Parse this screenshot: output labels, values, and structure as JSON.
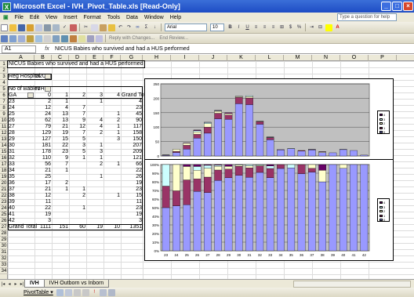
{
  "window": {
    "title": "Microsoft Excel - IVH_Pivot_Table.xls  [Read-Only]",
    "app_icon": "excel-icon"
  },
  "menu": {
    "items": [
      "File",
      "Edit",
      "View",
      "Insert",
      "Format",
      "Tools",
      "Data",
      "Window",
      "Help"
    ],
    "help_placeholder": "Type a question for help"
  },
  "toolbar": {
    "font_name": "Arial",
    "font_size": "10",
    "reply_label": "Reply with Changes...",
    "end_review_label": "End Review..."
  },
  "formula": {
    "cell_ref": "A1",
    "fx": "fx",
    "content": "NICUS Babies who survived and had a HUS performed"
  },
  "columns": [
    "A",
    "B",
    "C",
    "D",
    "E",
    "F",
    "G",
    "H",
    "I",
    "J",
    "K",
    "L",
    "M",
    "N",
    "O",
    "P"
  ],
  "rows": [
    "1",
    "2",
    "3",
    "4",
    "5",
    "6",
    "7",
    "8",
    "9",
    "10",
    "11",
    "12",
    "13",
    "14",
    "15",
    "16",
    "17",
    "18",
    "19",
    "20",
    "21",
    "22",
    "23",
    "24",
    "25",
    "26",
    "27",
    "28",
    "29",
    "30",
    "31",
    "32",
    "33",
    "34"
  ],
  "sheet": {
    "a1": "NICUS Babies who survived and had a HUS performed",
    "filter_label": "Reg Hospital",
    "filter_value": "D209",
    "data_label": "No of Babies",
    "col_field": "IVH",
    "row_field": "GA",
    "col_headers": [
      "0",
      "1",
      "2",
      "3",
      "4",
      "Grand Total"
    ],
    "table": [
      [
        "23",
        "2",
        "1",
        "",
        "1",
        "",
        "4"
      ],
      [
        "24",
        "12",
        "4",
        "7",
        "",
        "",
        "23"
      ],
      [
        "25",
        "24",
        "13",
        "7",
        "",
        "1",
        "45"
      ],
      [
        "26",
        "62",
        "13",
        "9",
        "4",
        "2",
        "90"
      ],
      [
        "27",
        "79",
        "21",
        "12",
        "4",
        "1",
        "117"
      ],
      [
        "28",
        "129",
        "19",
        "7",
        "2",
        "1",
        "158"
      ],
      [
        "29",
        "127",
        "15",
        "5",
        "",
        "3",
        "150"
      ],
      [
        "30",
        "181",
        "22",
        "3",
        "1",
        "",
        "207"
      ],
      [
        "31",
        "178",
        "23",
        "5",
        "3",
        "",
        "209"
      ],
      [
        "32",
        "110",
        "9",
        "1",
        "1",
        "",
        "121"
      ],
      [
        "33",
        "56",
        "7",
        "",
        "2",
        "1",
        "66"
      ],
      [
        "34",
        "21",
        "1",
        "",
        "",
        "",
        "22"
      ],
      [
        "35",
        "25",
        "",
        "",
        "1",
        "",
        "26"
      ],
      [
        "36",
        "17",
        "2",
        "",
        "",
        "",
        "19"
      ],
      [
        "37",
        "21",
        "1",
        "1",
        "",
        "",
        "23"
      ],
      [
        "38",
        "12",
        "",
        "2",
        "",
        "1",
        "15"
      ],
      [
        "39",
        "11",
        "",
        "",
        "",
        "",
        "11"
      ],
      [
        "40",
        "22",
        "",
        "1",
        "",
        "",
        "23"
      ],
      [
        "41",
        "19",
        "",
        "",
        "",
        "",
        "19"
      ],
      [
        "42",
        "3",
        "",
        "",
        "",
        "",
        "3"
      ]
    ],
    "grand_total": [
      "Grand Total",
      "1111",
      "151",
      "60",
      "19",
      "10",
      "1351"
    ]
  },
  "tabs": {
    "active": "IVH",
    "items": [
      "IVH",
      "IVH Outborn vs Inborn"
    ]
  },
  "pivot_toolbar": {
    "label": "PivotTable ▾"
  },
  "colors": {
    "s0": "#9999ff",
    "s1": "#993366",
    "s2": "#ffffcc",
    "s3": "#ccffff",
    "s4": "#660066",
    "plot_bg": "#c0c0c0"
  },
  "chart_data": [
    {
      "type": "bar",
      "stacked": true,
      "categories": [
        "23",
        "24",
        "25",
        "26",
        "27",
        "28",
        "29",
        "30",
        "31",
        "32",
        "33",
        "34",
        "35",
        "36",
        "37",
        "38",
        "39",
        "40",
        "41",
        "42"
      ],
      "series": [
        {
          "name": "0",
          "values": [
            2,
            12,
            24,
            62,
            79,
            129,
            127,
            181,
            178,
            110,
            56,
            21,
            25,
            17,
            21,
            12,
            11,
            22,
            19,
            3
          ]
        },
        {
          "name": "1",
          "values": [
            1,
            4,
            13,
            13,
            21,
            19,
            15,
            22,
            23,
            9,
            7,
            1,
            0,
            2,
            1,
            0,
            0,
            0,
            0,
            0
          ]
        },
        {
          "name": "2",
          "values": [
            0,
            7,
            7,
            9,
            12,
            7,
            5,
            3,
            5,
            1,
            0,
            0,
            0,
            0,
            1,
            2,
            0,
            1,
            0,
            0
          ]
        },
        {
          "name": "3",
          "values": [
            1,
            0,
            0,
            4,
            4,
            2,
            0,
            1,
            3,
            1,
            2,
            0,
            1,
            0,
            0,
            0,
            0,
            0,
            0,
            0
          ]
        },
        {
          "name": "4",
          "values": [
            0,
            0,
            1,
            2,
            1,
            1,
            3,
            0,
            0,
            0,
            1,
            0,
            0,
            0,
            0,
            1,
            0,
            0,
            0,
            0
          ]
        }
      ],
      "yticks": [
        "0",
        "50",
        "100",
        "150",
        "200",
        "250"
      ],
      "ylim": [
        0,
        250
      ],
      "grid": true,
      "legend": "right"
    },
    {
      "type": "bar",
      "stacked": true,
      "percent": true,
      "categories": [
        "23",
        "24",
        "25",
        "26",
        "27",
        "28",
        "29",
        "30",
        "31",
        "32",
        "33",
        "34",
        "35",
        "36",
        "37",
        "38",
        "39",
        "40",
        "41",
        "42"
      ],
      "series": [
        {
          "name": "0"
        },
        {
          "name": "1"
        },
        {
          "name": "2"
        },
        {
          "name": "3"
        },
        {
          "name": "4"
        }
      ],
      "yticks": [
        "0%",
        "10%",
        "20%",
        "30%",
        "40%",
        "50%",
        "60%",
        "70%",
        "80%",
        "90%",
        "100%"
      ],
      "ylim": [
        0,
        100
      ],
      "grid": true,
      "legend": "right"
    }
  ]
}
